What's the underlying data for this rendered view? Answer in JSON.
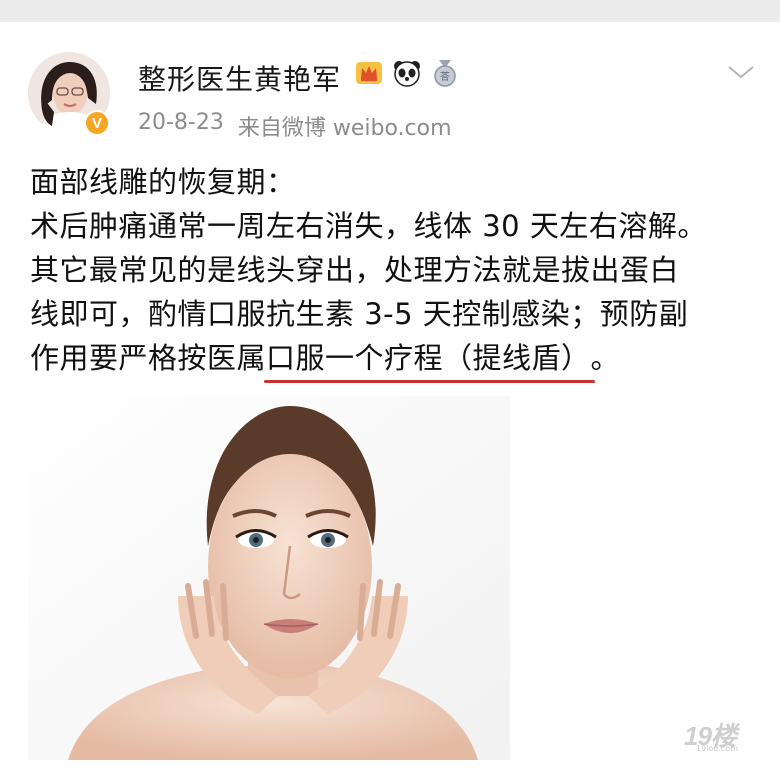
{
  "post": {
    "author_name": "整形医生黄艳军",
    "date": "20-8-23",
    "source": "来自微博 weibo.com",
    "verified_badge": "V",
    "lines": [
      "面部线雕的恢复期：",
      "术后肿痛通常一周左右消失，线体 30 天左右溶解。",
      "其它最常见的是线头穿出，处理方法就是拔出蛋白",
      "线即可，酌情口服抗生素 3-5 天控制感染；预防副"
    ],
    "last_line_prefix": "作用要严格按医属",
    "last_line_highlight": "口服一个疗程（提线盾）",
    "last_line_suffix": "。",
    "icons": [
      "crown-icon",
      "panda-icon",
      "medal-icon",
      "chevron-down-icon"
    ]
  },
  "watermark": {
    "main": "19楼",
    "sub": "19lou.com"
  },
  "colors": {
    "highlight_underline": "#c8332f",
    "meta": "#8c8c8c",
    "verified": "#f5a623"
  }
}
